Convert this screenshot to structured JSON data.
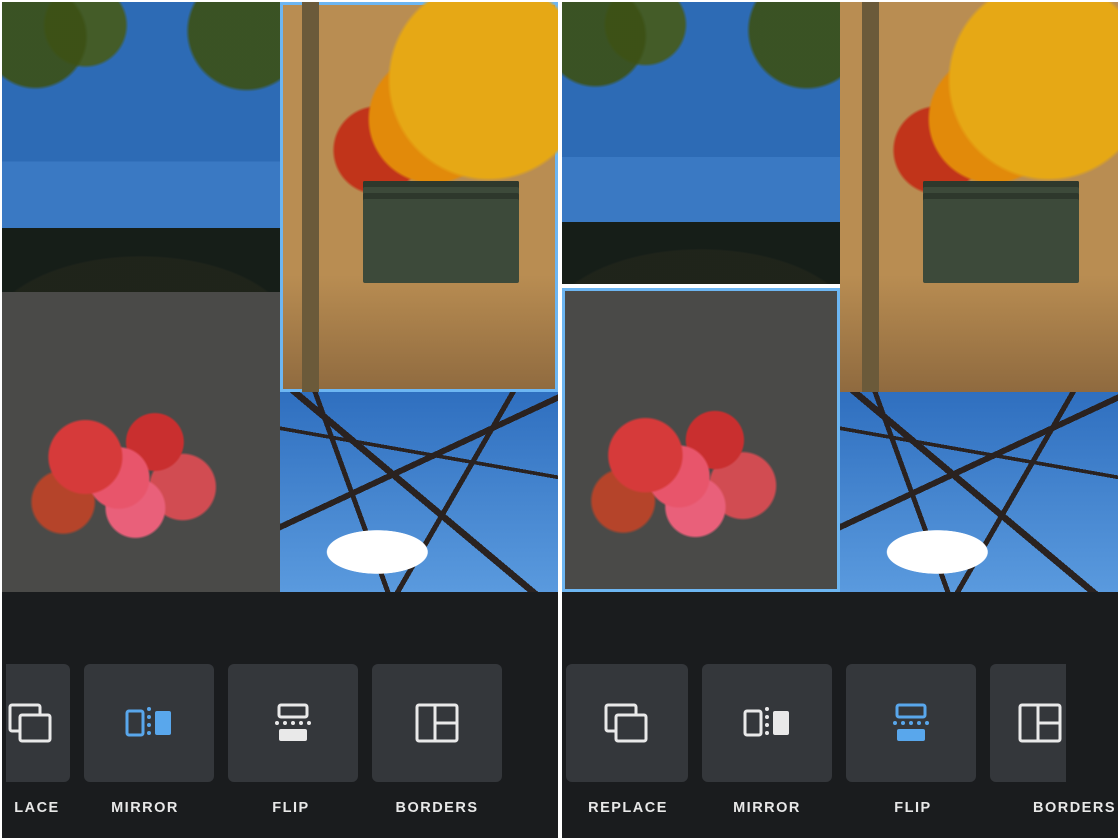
{
  "accent": "#59a7ec",
  "selection_color": "#6db6f2",
  "left": {
    "toolbar": {
      "replace": "LACE",
      "mirror": "MIRROR",
      "flip": "FLIP",
      "borders": "BORDERS"
    },
    "active_tool": "mirror",
    "selected_slot": "top-right",
    "slots": {
      "top_left": "sky-clouds-foliage",
      "top_right": "park-bench-autumn",
      "bottom_left": "red-leaves-pavement",
      "bottom_right": "bare-branches-sky"
    }
  },
  "right": {
    "toolbar": {
      "replace": "REPLACE",
      "mirror": "MIRROR",
      "flip": "FLIP",
      "borders": "BORDERS"
    },
    "active_tool": "flip",
    "selected_slot": "bottom-left",
    "slots": {
      "top_left": "sky-clouds-foliage",
      "top_right": "park-bench-autumn",
      "bottom_left": "red-leaves-pavement",
      "bottom_right": "bare-branches-sky"
    }
  }
}
